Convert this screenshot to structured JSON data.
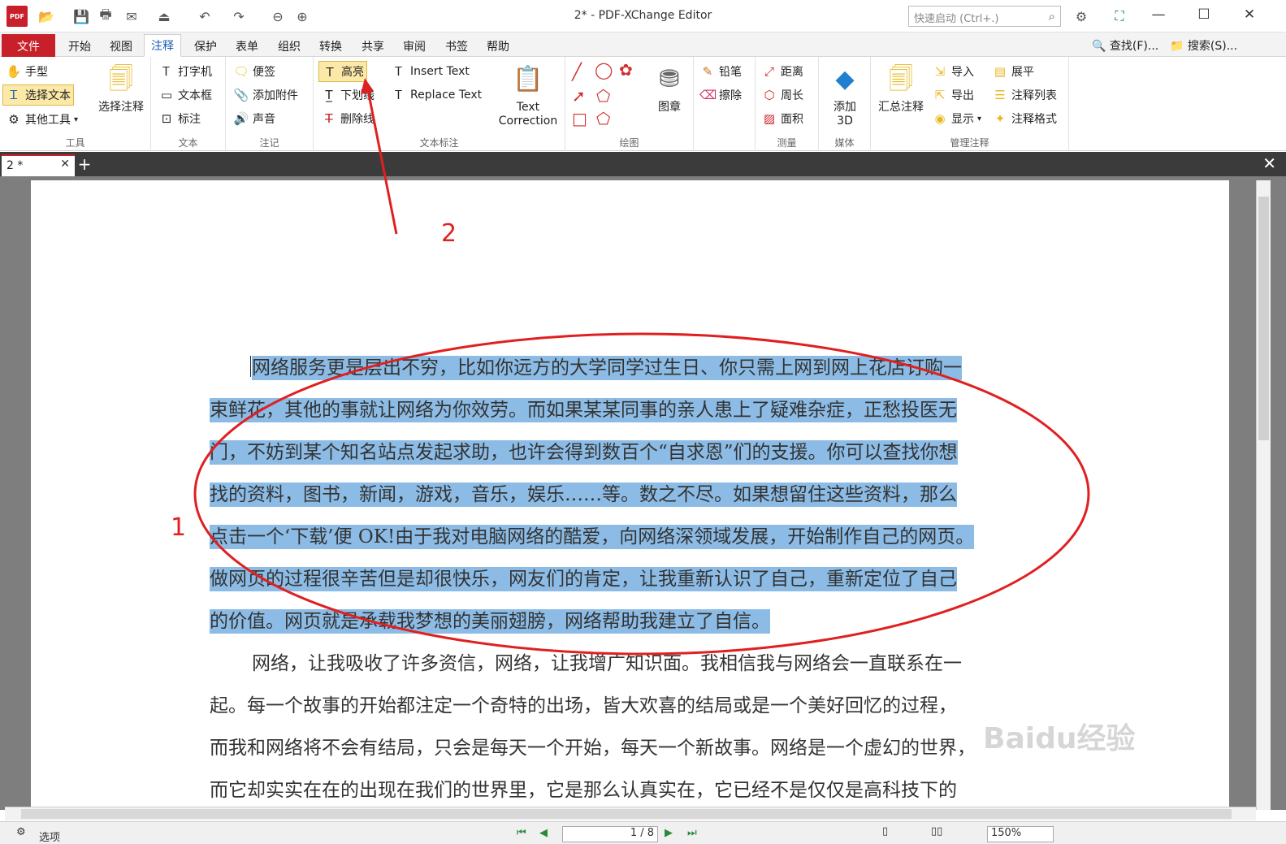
{
  "window": {
    "title": "2* - PDF-XChange Editor",
    "quick_launch_placeholder": "快速启动 (Ctrl+.)",
    "logo_text": "PDF"
  },
  "menu": {
    "file": "文件",
    "tabs": [
      "开始",
      "视图",
      "注释",
      "保护",
      "表单",
      "组织",
      "转换",
      "共享",
      "审阅",
      "书签",
      "帮助"
    ],
    "find": "查找(F)...",
    "search": "搜索(S)..."
  },
  "ribbon": {
    "tools": {
      "label": "工具",
      "hand": "手型",
      "select_text": "选择文本",
      "other_tools": "其他工具",
      "select_annot": "选择注释"
    },
    "text": {
      "label": "文本",
      "typewriter": "打字机",
      "textbox": "文本框",
      "callout": "标注"
    },
    "note": {
      "label": "注记",
      "sticky": "便签",
      "attach": "添加附件",
      "sound": "声音"
    },
    "markup": {
      "label": "文本标注",
      "highlight": "高亮",
      "underline": "下划线",
      "strike": "删除线",
      "insert_text": "Insert Text",
      "replace_text": "Replace Text",
      "text_correction_1": "Text",
      "text_correction_2": "Correction"
    },
    "draw": {
      "label": "绘图",
      "stamp": "图章"
    },
    "pencil": {
      "pencil": "铅笔",
      "eraser": "擦除"
    },
    "measure": {
      "label": "测量",
      "distance": "距离",
      "perimeter": "周长",
      "area": "面积"
    },
    "media": {
      "label": "媒体",
      "add3d_1": "添加",
      "add3d_2": "3D"
    },
    "manage": {
      "label": "管理注释",
      "summary": "汇总注释",
      "import": "导入",
      "export": "导出",
      "show": "显示",
      "flatten": "展平",
      "list": "注释列表",
      "format": "注释格式"
    }
  },
  "doc_tab": {
    "name": "2 *"
  },
  "document": {
    "highlighted_lines": [
      "网络服务更是层出不穷，比如你远方的大学同学过生日、你只需上网到网上花店订购一",
      "束鲜花，其他的事就让网络为你效劳。而如果某某同事的亲人患上了疑难杂症，正愁投医无",
      "门，不妨到某个知名站点发起求助，也许会得到数百个“自求恩”们的支援。你可以查找你想",
      "找的资料，图书，新闻，游戏，音乐，娱乐……等。数之不尽。如果想留住这些资料，那么",
      "点击一个‘下载’便 OK!由于我对电脑网络的酷爱，向网络深领域发展，开始制作自己的网页。",
      "做网页的过程很辛苦但是却很快乐，网友们的肯定，让我重新认识了自己，重新定位了自己",
      "的价值。网页就是承载我梦想的美丽翅膀，网络帮助我建立了自信。"
    ],
    "plain_lines": [
      "网络，让我吸收了许多资信，网络，让我增广知识面。我相信我与网络会一直联系在一",
      "起。每一个故事的开始都注定一个奇特的出场，皆大欢喜的结局或是一个美好回忆的过程，",
      "而我和网络将不会有结局，只会是每天一个开始，每天一个新故事。网络是一个虚幻的世界，",
      "而它却实实在在的出现在我们的世界里，它是那么认真实在，它已经不是仅仅是高科技下的"
    ]
  },
  "annotations": {
    "label_1": "1",
    "label_2": "2",
    "color": "#e02020"
  },
  "watermark": {
    "text": "Baidu经验"
  },
  "status": {
    "options": "选项",
    "page": "1 / 8",
    "zoom": "150%"
  },
  "colors": {
    "accent": "#c8202a",
    "highlight": "#8cbce6",
    "selected": "#fce9a8"
  }
}
